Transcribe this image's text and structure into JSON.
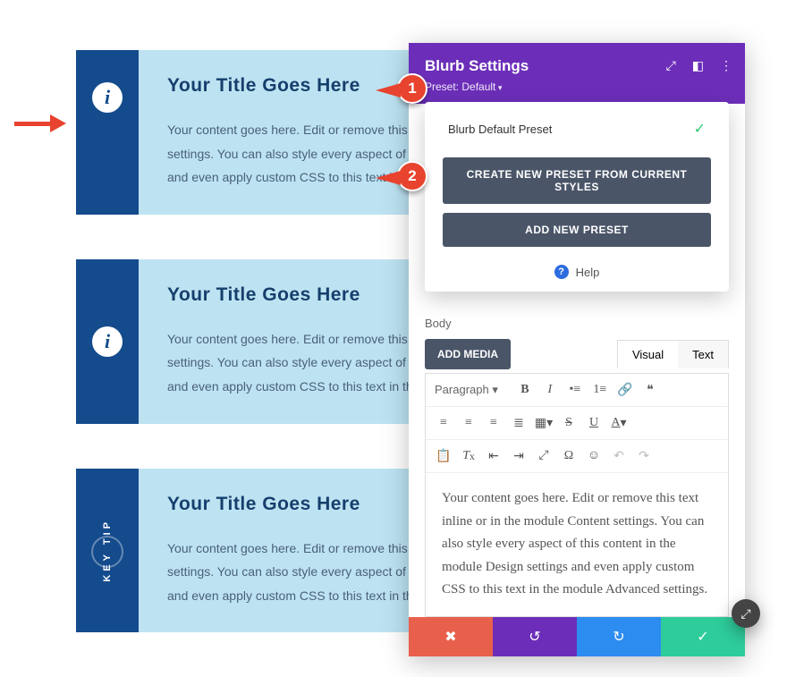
{
  "cards": [
    {
      "title": "Your Title Goes Here",
      "text": "Your content goes here. Edit or remove this text inline or in the module Content settings. You can also style every aspect of this content in the module Design settings and even apply custom CSS to this text in the module Advanced settings."
    },
    {
      "title": "Your Title Goes Here",
      "text": "Your content goes here. Edit or remove this text inline or in the module Content settings. You can also style every aspect of this content in the module Design settings and even apply custom CSS to this text in the module Advanced settings."
    },
    {
      "title": "Your Title Goes Here",
      "text": "Your content goes here. Edit or remove this text inline or in the module Content settings. You can also style every aspect of this content in the module Design settings and even apply custom CSS to this text in the module Advanced settings.",
      "stripe_label": "KEY  TIP"
    }
  ],
  "panel": {
    "title": "Blurb Settings",
    "preset_label": "Preset: Default"
  },
  "dropdown": {
    "preset_name": "Blurb Default Preset",
    "create_btn": "CREATE NEW PRESET FROM CURRENT STYLES",
    "add_btn": "ADD NEW PRESET",
    "help": "Help"
  },
  "form": {
    "body_label": "Body",
    "add_media": "ADD MEDIA",
    "tab_visual": "Visual",
    "tab_text": "Text",
    "format_select": "Paragraph",
    "content": "Your content goes here. Edit or remove this text inline or in the module Content settings. You can also style every aspect of this content in the module Design settings and even apply custom CSS to this text in the module Advanced settings."
  },
  "callouts": {
    "c1": "1",
    "c2": "2"
  }
}
